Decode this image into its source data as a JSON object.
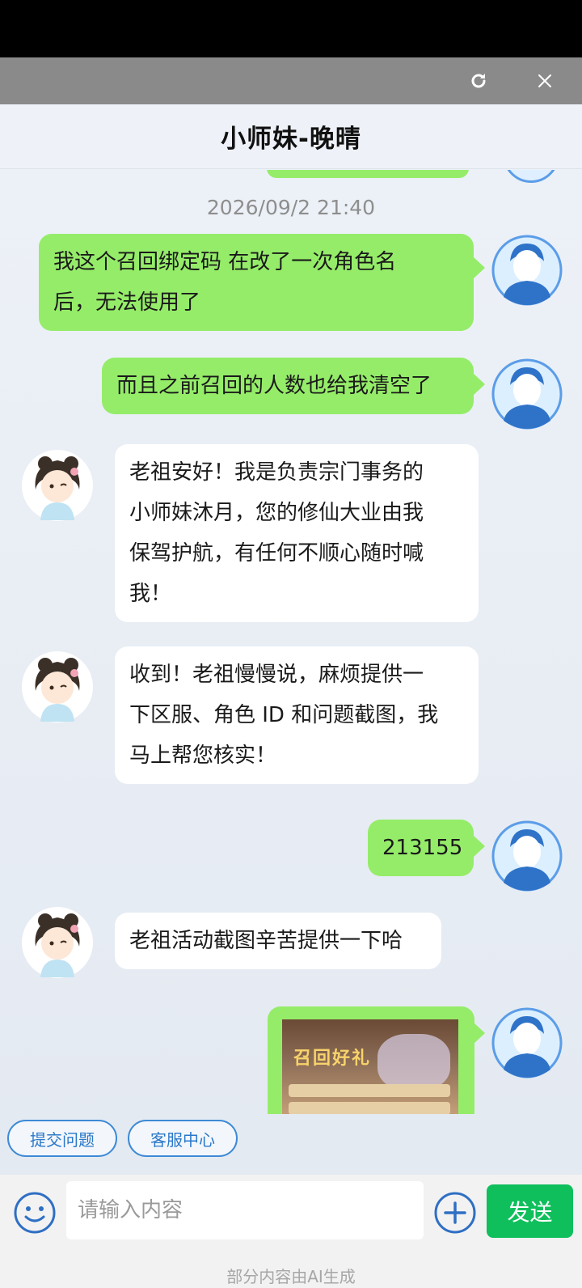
{
  "window": {
    "refresh_icon": "refresh-icon",
    "close_icon": "close-icon"
  },
  "header": {
    "title": "小师妹-晚晴"
  },
  "chat": {
    "timestamp": "2026/09/2 21:40",
    "messages": [
      {
        "side": "me",
        "lines": [
          "我这个召回绑定码 在改了一次角色名",
          "后，无法使用了"
        ]
      },
      {
        "side": "me",
        "lines": [
          "而且之前召回的人数也给我清空了"
        ]
      },
      {
        "side": "other",
        "lines": [
          "老祖安好！我是负责宗门事务的",
          "小师妹沐月，您的修仙大业由我",
          "保驾护航，有任何不顺心随时喊",
          "我！"
        ]
      },
      {
        "side": "other",
        "lines": [
          "收到！老祖慢慢说，麻烦提供一",
          "下区服、角色 ID 和问题截图，我",
          "马上帮您核实！"
        ]
      },
      {
        "side": "me",
        "lines": [
          "213155"
        ]
      },
      {
        "side": "other",
        "lines": [
          "老祖活动截图辛苦提供一下哈"
        ]
      },
      {
        "side": "me",
        "type": "image",
        "image_caption": "召回好礼"
      }
    ]
  },
  "quick_actions": {
    "submit_issue": "提交问题",
    "service_center": "客服中心"
  },
  "composer": {
    "placeholder": "请输入内容",
    "emoji_icon": "smiley-icon",
    "plus_icon": "plus-circle-icon",
    "send_label": "发送",
    "ai_notice": "部分内容由AI生成"
  },
  "colors": {
    "my_bubble": "#95ec69",
    "send_button": "#0fbf5c",
    "quick_action_border": "#3d8ad6"
  }
}
